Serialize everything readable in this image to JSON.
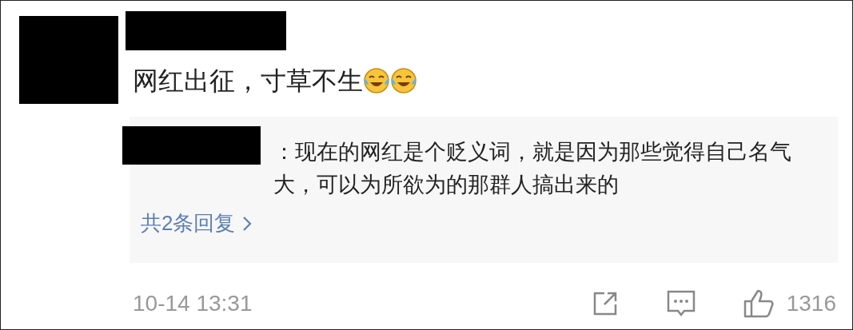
{
  "comment": {
    "text": "网红出征，寸草不生",
    "emojis": [
      {
        "kind": "laugh-cry"
      },
      {
        "kind": "laugh-cry"
      }
    ]
  },
  "reply": {
    "text": "：现在的网红是个贬义词，就是因为那些觉得自己名气大，可以为所欲为的那群人搞出来的",
    "more_link": "共2条回复"
  },
  "footer": {
    "time": "10-14 13:31",
    "like_count": "1316"
  }
}
